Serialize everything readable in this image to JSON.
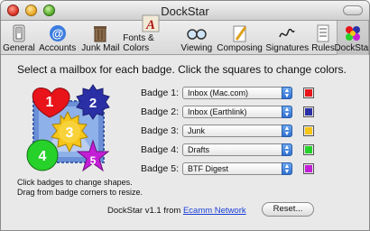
{
  "window": {
    "title": "DockStar"
  },
  "toolbar": {
    "items": [
      {
        "label": "General",
        "icon": "light-switch-icon"
      },
      {
        "label": "Accounts",
        "icon": "at-sign-icon"
      },
      {
        "label": "Junk Mail",
        "icon": "trash-bin-icon"
      },
      {
        "label": "Fonts & Colors",
        "icon": "font-a-icon"
      },
      {
        "label": "Viewing",
        "icon": "glasses-icon"
      },
      {
        "label": "Composing",
        "icon": "pencil-paper-icon"
      },
      {
        "label": "Signatures",
        "icon": "signature-icon"
      },
      {
        "label": "Rules",
        "icon": "rules-icon"
      },
      {
        "label": "DockStar",
        "icon": "dockstar-icon",
        "selected": true
      }
    ]
  },
  "main": {
    "instructions": "Select a mailbox for each badge.  Click the squares to change colors.",
    "hint_line1": "Click badges to change shapes.",
    "hint_line2": "Drag from badge corners to resize.",
    "badge_numbers": [
      "1",
      "2",
      "3",
      "4",
      "5"
    ],
    "badges": [
      {
        "label": "Badge 1:",
        "mailbox": "Inbox (Mac.com)",
        "color": "#e8141a"
      },
      {
        "label": "Badge 2:",
        "mailbox": "Inbox (Earthlink)",
        "color": "#2b2fa6"
      },
      {
        "label": "Badge 3:",
        "mailbox": "Junk",
        "color": "#f5c518"
      },
      {
        "label": "Badge 4:",
        "mailbox": "Drafts",
        "color": "#26d12a"
      },
      {
        "label": "Badge 5:",
        "mailbox": "BTF Digest",
        "color": "#c31fd6"
      }
    ]
  },
  "footer": {
    "version_text": "DockStar v1.1 from",
    "link_text": "Ecamm Network",
    "reset_label": "Reset..."
  }
}
